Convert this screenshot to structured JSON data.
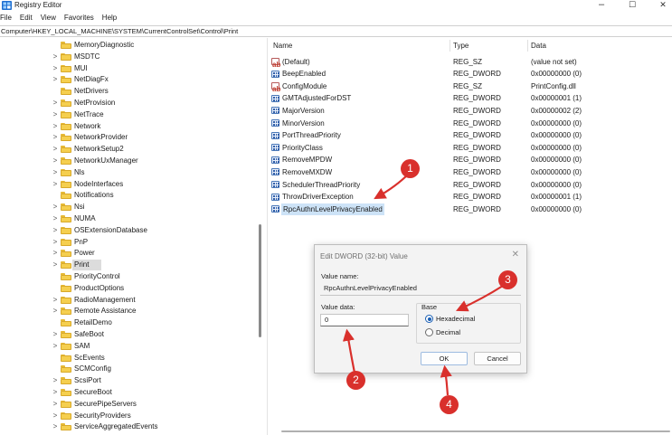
{
  "window": {
    "title": "Registry Editor",
    "minimize_glyph": "–",
    "maximize_glyph": "☐",
    "close_glyph": "✕"
  },
  "menu": [
    "File",
    "Edit",
    "View",
    "Favorites",
    "Help"
  ],
  "address": "Computer\\HKEY_LOCAL_MACHINE\\SYSTEM\\CurrentControlSet\\Control\\Print",
  "tree": {
    "items": [
      {
        "label": "MemoryDiagnostic",
        "expandable": false
      },
      {
        "label": "MSDTC",
        "expandable": true
      },
      {
        "label": "MUI",
        "expandable": true
      },
      {
        "label": "NetDiagFx",
        "expandable": true
      },
      {
        "label": "NetDrivers",
        "expandable": false
      },
      {
        "label": "NetProvision",
        "expandable": true
      },
      {
        "label": "NetTrace",
        "expandable": true
      },
      {
        "label": "Network",
        "expandable": true
      },
      {
        "label": "NetworkProvider",
        "expandable": true
      },
      {
        "label": "NetworkSetup2",
        "expandable": true
      },
      {
        "label": "NetworkUxManager",
        "expandable": true
      },
      {
        "label": "Nls",
        "expandable": true
      },
      {
        "label": "NodeInterfaces",
        "expandable": true
      },
      {
        "label": "Notifications",
        "expandable": false
      },
      {
        "label": "Nsi",
        "expandable": true
      },
      {
        "label": "NUMA",
        "expandable": true
      },
      {
        "label": "OSExtensionDatabase",
        "expandable": true
      },
      {
        "label": "PnP",
        "expandable": true
      },
      {
        "label": "Power",
        "expandable": true
      },
      {
        "label": "Print",
        "expandable": true,
        "selected": true
      },
      {
        "label": "PriorityControl",
        "expandable": false
      },
      {
        "label": "ProductOptions",
        "expandable": false
      },
      {
        "label": "RadioManagement",
        "expandable": true
      },
      {
        "label": "Remote Assistance",
        "expandable": true
      },
      {
        "label": "RetailDemo",
        "expandable": false
      },
      {
        "label": "SafeBoot",
        "expandable": true
      },
      {
        "label": "SAM",
        "expandable": true
      },
      {
        "label": "ScEvents",
        "expandable": false
      },
      {
        "label": "SCMConfig",
        "expandable": false
      },
      {
        "label": "ScsiPort",
        "expandable": true
      },
      {
        "label": "SecureBoot",
        "expandable": true
      },
      {
        "label": "SecurePipeServers",
        "expandable": true
      },
      {
        "label": "SecurityProviders",
        "expandable": true
      },
      {
        "label": "ServiceAggregatedEvents",
        "expandable": true
      }
    ],
    "chevron_glyph": ">"
  },
  "list": {
    "columns": {
      "name": "Name",
      "type": "Type",
      "data": "Data"
    },
    "rows": [
      {
        "icon": "string-value-icon",
        "name": "(Default)",
        "type": "REG_SZ",
        "data": "(value not set)"
      },
      {
        "icon": "dword-value-icon",
        "name": "BeepEnabled",
        "type": "REG_DWORD",
        "data": "0x00000000 (0)"
      },
      {
        "icon": "string-value-icon",
        "name": "ConfigModule",
        "type": "REG_SZ",
        "data": "PrintConfig.dll"
      },
      {
        "icon": "dword-value-icon",
        "name": "GMTAdjustedForDST",
        "type": "REG_DWORD",
        "data": "0x00000001 (1)"
      },
      {
        "icon": "dword-value-icon",
        "name": "MajorVersion",
        "type": "REG_DWORD",
        "data": "0x00000002 (2)"
      },
      {
        "icon": "dword-value-icon",
        "name": "MinorVersion",
        "type": "REG_DWORD",
        "data": "0x00000000 (0)"
      },
      {
        "icon": "dword-value-icon",
        "name": "PortThreadPriority",
        "type": "REG_DWORD",
        "data": "0x00000000 (0)"
      },
      {
        "icon": "dword-value-icon",
        "name": "PriorityClass",
        "type": "REG_DWORD",
        "data": "0x00000000 (0)"
      },
      {
        "icon": "dword-value-icon",
        "name": "RemoveMPDW",
        "type": "REG_DWORD",
        "data": "0x00000000 (0)"
      },
      {
        "icon": "dword-value-icon",
        "name": "RemoveMXDW",
        "type": "REG_DWORD",
        "data": "0x00000000 (0)"
      },
      {
        "icon": "dword-value-icon",
        "name": "SchedulerThreadPriority",
        "type": "REG_DWORD",
        "data": "0x00000000 (0)"
      },
      {
        "icon": "dword-value-icon",
        "name": "ThrowDriverException",
        "type": "REG_DWORD",
        "data": "0x00000001 (1)"
      },
      {
        "icon": "dword-value-icon",
        "name": "RpcAuthnLevelPrivacyEnabled",
        "type": "REG_DWORD",
        "data": "0x00000000 (0)",
        "selected": true
      }
    ]
  },
  "dialog": {
    "title": "Edit DWORD (32-bit) Value",
    "close_glyph": "✕",
    "value_name_label": "Value name:",
    "value_name": "RpcAuthnLevelPrivacyEnabled",
    "value_data_label": "Value data:",
    "value_data": "0",
    "base_label": "Base",
    "hex_label": "Hexadecimal",
    "dec_label": "Decimal",
    "selected_base": "Hexadecimal",
    "ok_label": "OK",
    "cancel_label": "Cancel"
  },
  "callouts": {
    "c1": "1",
    "c2": "2",
    "c3": "3",
    "c4": "4",
    "color": "#d9302c"
  }
}
